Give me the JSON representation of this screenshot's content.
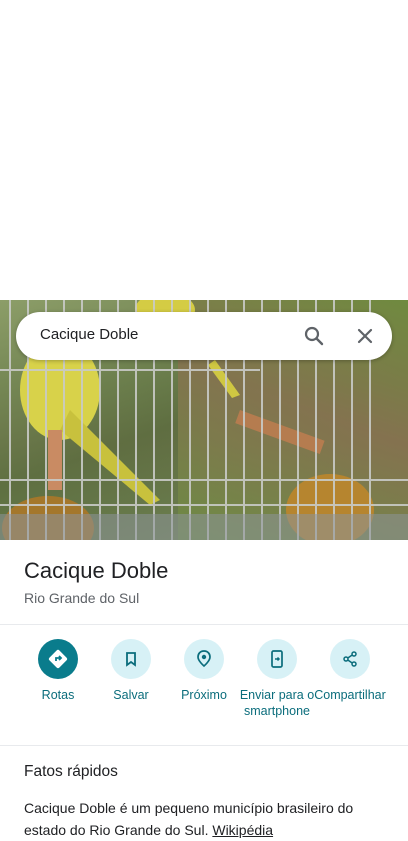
{
  "search": {
    "query": "Cacique Doble"
  },
  "place": {
    "title": "Cacique Doble",
    "subtitle": "Rio Grande do Sul"
  },
  "actions": [
    {
      "label": "Rotas",
      "icon": "directions-icon"
    },
    {
      "label": "Salvar",
      "icon": "bookmark-icon"
    },
    {
      "label": "Próximo",
      "icon": "nearby-icon"
    },
    {
      "label": "Enviar para o smartphone",
      "icon": "send-to-phone-icon"
    },
    {
      "label": "Compartilhar",
      "icon": "share-icon"
    }
  ],
  "quick_facts": {
    "title": "Fatos rápidos",
    "description": "Cacique Doble é um pequeno município brasileiro do estado do Rio Grande do Sul.",
    "source_link": "Wikipédia"
  },
  "colors": {
    "accent": "#0a7c8c",
    "accent_light": "#d7f1f6",
    "label": "#0b6d7c"
  }
}
